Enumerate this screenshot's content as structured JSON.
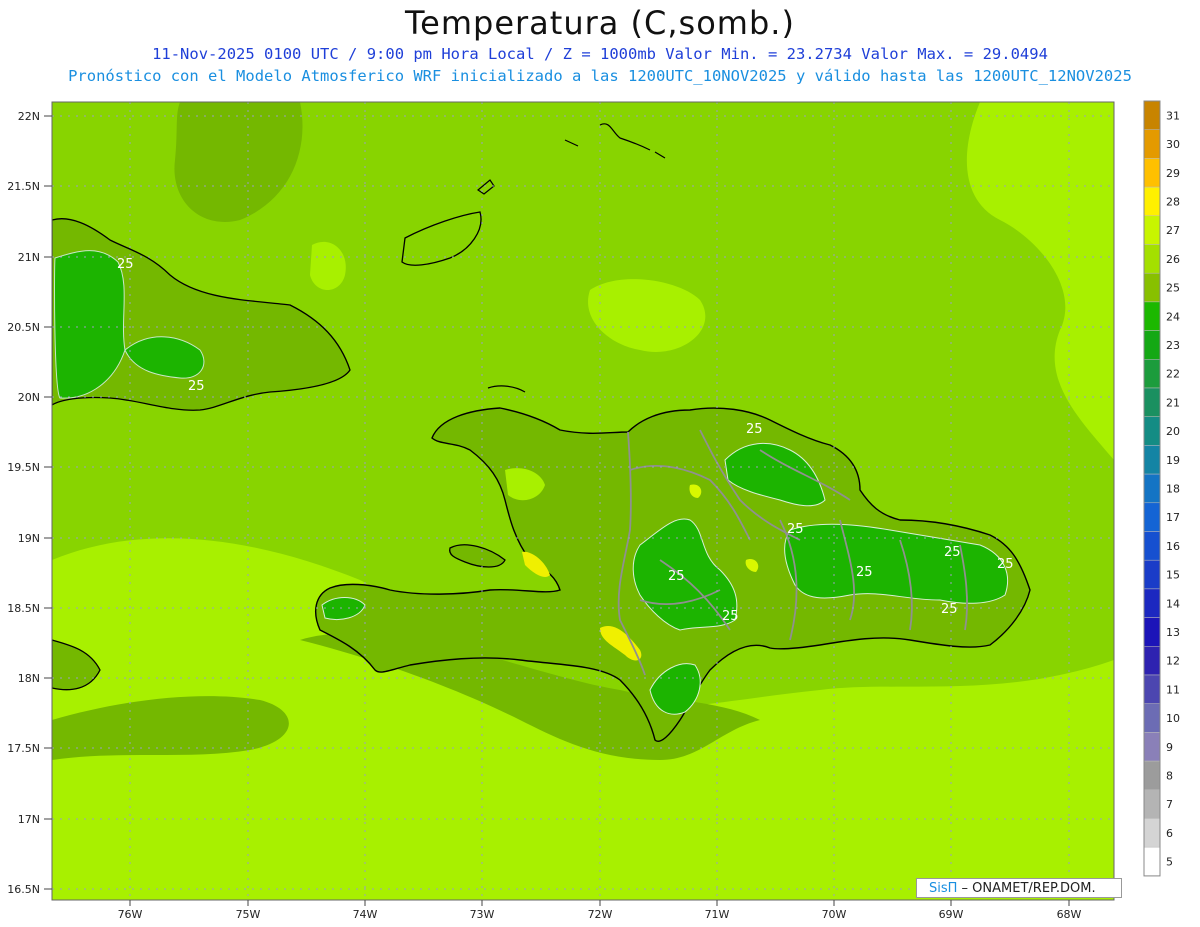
{
  "header": {
    "title": "Temperatura (C,somb.)",
    "line1": "11-Nov-2025 0100 UTC / 9:00 pm Hora Local / Z = 1000mb   Valor Min. = 23.2734  Valor Max. = 29.0494",
    "line2": "Pronóstico con el Modelo Atmosferico WRF inicializado a las 1200UTC_10NOV2025 y válido hasta las  1200UTC_12NOV2025"
  },
  "credit": {
    "brand": "SisΠ",
    "text": " – ONAMET/REP.DOM."
  },
  "axes": {
    "lat_labels": [
      "22N",
      "21.5N",
      "21N",
      "20.5N",
      "20N",
      "19.5N",
      "19N",
      "18.5N",
      "18N",
      "17.5N",
      "17N",
      "16.5N"
    ],
    "lon_labels": [
      "76W",
      "75W",
      "74W",
      "73W",
      "72W",
      "71W",
      "70W",
      "69W",
      "68W"
    ],
    "lat_range": [
      16.4,
      22.1
    ],
    "lon_range": [
      -76.65,
      -67.6
    ]
  },
  "contour_labels": [
    "25",
    "25",
    "25",
    "25",
    "25",
    "25",
    "25",
    "25",
    "25",
    "25"
  ],
  "colorbar": {
    "levels": [
      "31",
      "30",
      "29",
      "28",
      "27",
      "26",
      "25",
      "24",
      "23",
      "22",
      "21",
      "20",
      "19",
      "18",
      "17",
      "16",
      "15",
      "14",
      "13",
      "12",
      "11",
      "10",
      "9",
      "8",
      "7",
      "6",
      "5"
    ],
    "colors": [
      "#c88400",
      "#e49a00",
      "#ffc000",
      "#fff000",
      "#c8f500",
      "#a4e000",
      "#88c000",
      "#1cb800",
      "#14a814",
      "#1c9c3c",
      "#1a9060",
      "#148c84",
      "#1484a4",
      "#1474c4",
      "#1464d4",
      "#1650d0",
      "#1a3cc8",
      "#1c28c0",
      "#1c14b8",
      "#2e22b0",
      "#4c46b0",
      "#6c6cb4",
      "#8a80b8",
      "#9c9c9c",
      "#b4b4b4",
      "#d4d4d4",
      "#ffffff"
    ]
  },
  "map_colors": {
    "sea": "#88d400",
    "light": "#a8f000",
    "mid": "#74b800",
    "dark": "#1cb400",
    "warm": "#f0f000",
    "coast": "#000000",
    "border": "#909090"
  }
}
